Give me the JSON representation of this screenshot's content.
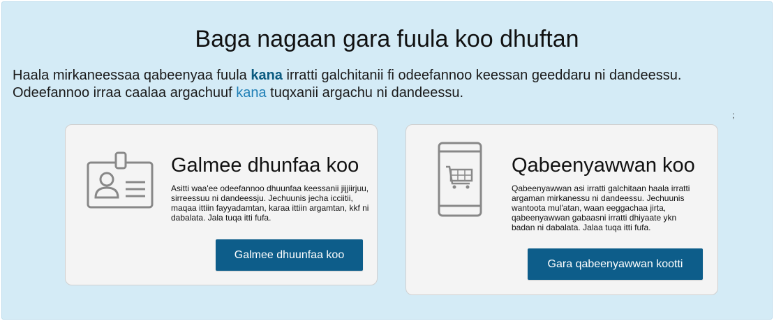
{
  "page": {
    "title": "Baga nagaan gara fuula koo dhuftan",
    "intro_part1": "Haala mirkaneessaa qabeenyaa fuula ",
    "intro_link1": "kana",
    "intro_part2": " irratti galchitanii fi odeefannoo keessan geeddaru ni dandeessu. Odeefannoo irraa caalaa argachuuf ",
    "intro_link2": "kana",
    "intro_part3": " tuqxanii argachu ni dandeessu.",
    "stray_char": ";"
  },
  "cards": [
    {
      "heading": "Galmee dhunfaa koo",
      "text": "Asitti waa'ee odeefannoo dhuunfaa keessanii jijjiirjuu, sirreessuu ni dandeessju. Jechuunis jecha icciitii, maqaa ittiin fayyadamtan, karaa ittiin argamtan, kkf ni dabalata. Jala tuqa itti fufa.",
      "button": "Galmee dhuunfaa koo",
      "icon": "id-card-icon"
    },
    {
      "heading": "Qabeenyawwan koo",
      "text": "Qabeenyawwan asi irratti galchitaan haala irratti argaman mirkanessu ni dandeessu. Jechuunis wantoota mul'atan, waan eeggachaa jirta, qabeenyawwan gabaasni irratti dhiyaate ykn badan ni dabalata. Jalaa tuqa itti fufa.",
      "button": "Gara qabeenyawwan kootti",
      "icon": "phone-cart-icon"
    }
  ],
  "colors": {
    "panel_bg": "#d4ebf6",
    "card_bg": "#f4f4f4",
    "button_bg": "#0d5d8a",
    "link_bold": "#0b5b80",
    "link": "#1f7fb6"
  }
}
